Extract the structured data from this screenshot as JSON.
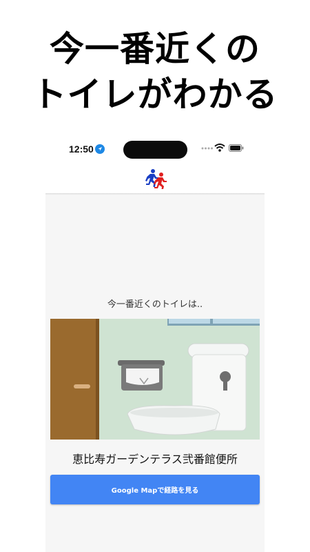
{
  "promo": {
    "headline_line1": "今一番近くの",
    "headline_line2": "トイレがわかる"
  },
  "status_bar": {
    "time": "12:50",
    "icons": [
      "location-arrow-icon",
      "signal-dots-icon",
      "wifi-icon",
      "battery-icon"
    ]
  },
  "app_bar": {
    "logo": "running-figures-logo"
  },
  "main": {
    "lead_text": "今一番近くのトイレは..",
    "illustration": "restroom-toilet-illustration",
    "toilet_name": "恵比寿ガーデンテラス弐番館便所",
    "route_button_label": "Google Mapで経路を見る"
  },
  "colors": {
    "button": "#4285f4",
    "content_bg": "#f6f6f6",
    "wall": "#cfe3d2",
    "door": "#9a6a2e",
    "logo_blue": "#1a3fc4",
    "logo_red": "#e02020"
  }
}
